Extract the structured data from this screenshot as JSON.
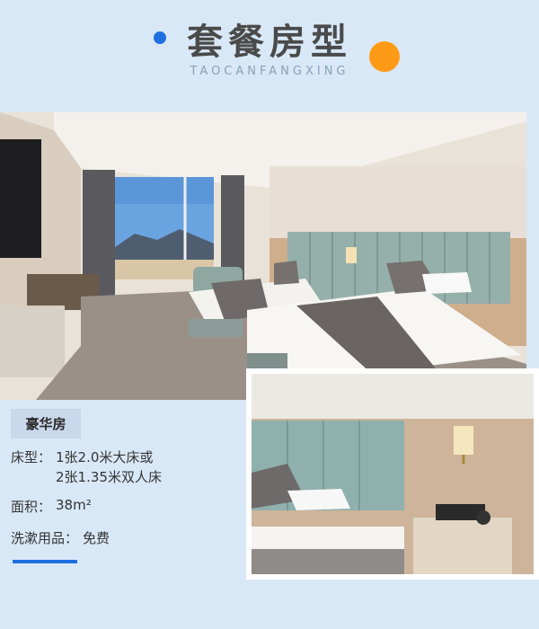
{
  "header": {
    "title": "套餐房型",
    "subtitle": "TAOCANFANGXING"
  },
  "room": {
    "name": "豪华房",
    "bed_type_label": "床型：",
    "bed_type_line1": "1张2.0米大床或",
    "bed_type_line2": "2张1.35米双人床",
    "area_label": "面积：",
    "area_value": "38m²",
    "toiletries_label": "洗漱用品：",
    "toiletries_value": "免费"
  },
  "colors": {
    "background": "#d9e8f7",
    "accent_blue": "#1f6fe0",
    "accent_orange": "#ff9a16"
  }
}
